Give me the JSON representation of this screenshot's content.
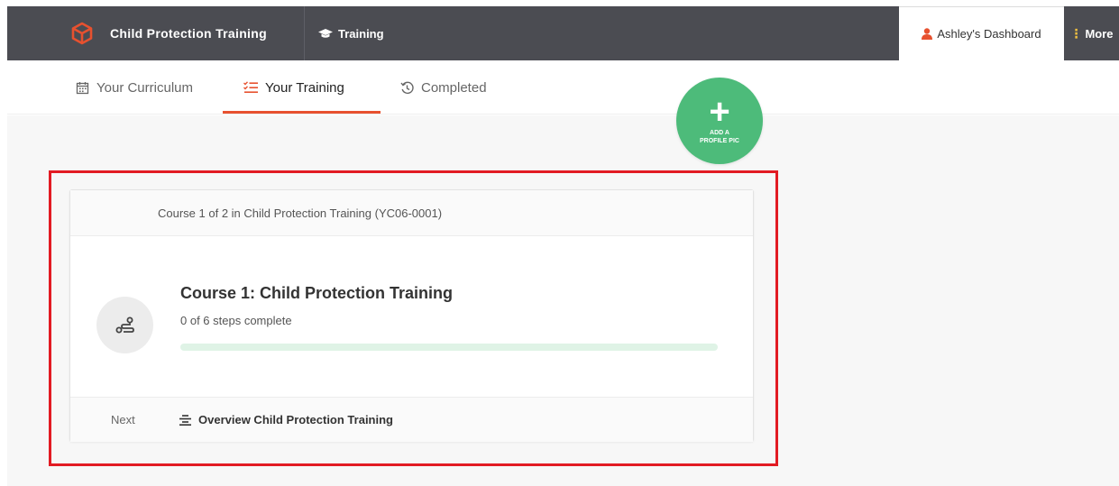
{
  "header": {
    "brand_title": "Child Protection Training",
    "brand_icon": "cube-logo-icon",
    "nav_training": "Training",
    "dashboard_label": "Ashley's Dashboard",
    "more_label": "More"
  },
  "tabs": [
    {
      "label": "Your Curriculum",
      "icon": "calendar-icon",
      "active": false
    },
    {
      "label": "Your Training",
      "icon": "checklist-icon",
      "active": true
    },
    {
      "label": "Completed",
      "icon": "history-icon",
      "active": false
    }
  ],
  "profile_fab": {
    "plus": "+",
    "label_line1": "ADD A",
    "label_line2": "PROFILE PIC"
  },
  "card": {
    "header_text": "Course 1 of 2 in Child Protection Training (YC06-0001)",
    "course_title": "Course 1: Child Protection Training",
    "steps_text": "0 of 6 steps complete",
    "progress_fraction": 0,
    "next_label": "Next",
    "next_item": "Overview Child Protection Training"
  },
  "colors": {
    "topbar": "#4b4c52",
    "accent": "#e7512f",
    "fab_green": "#4dbb7a",
    "highlight_red": "#e21b23"
  }
}
